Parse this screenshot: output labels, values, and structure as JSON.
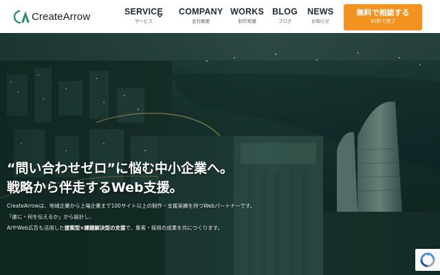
{
  "header": {
    "logo_text": "CreateArrow",
    "nav": [
      {
        "label": "SERVICE",
        "sub": "サービス"
      },
      {
        "label": "COMPANY",
        "sub": "会社概要"
      },
      {
        "label": "WORKS",
        "sub": "制作実績"
      },
      {
        "label": "BLOG",
        "sub": "ブログ"
      },
      {
        "label": "NEWS",
        "sub": "お知らせ"
      }
    ],
    "cta": {
      "label": "無料で相談する",
      "sub": "30秒で完了"
    }
  },
  "hero": {
    "headline_line1": "“問い合わせゼロ”に悩む中小企業へ。",
    "headline_line2": "戦略から伴走するWeb支援。",
    "desc_line1": "CreateArrowは、地域企業から上場企業まで100サイト以上の制作・支援実績を持つWebパートナーです。",
    "desc_line2": "「誰に・何を伝えるか」から設計し、",
    "desc_line3_a": "AIやWeb広告も活用した",
    "desc_line3_b": "提案型×課題解決型の支援",
    "desc_line3_c": "で、集客・採用の成果を共につくります。"
  },
  "colors": {
    "accent": "#f1931e",
    "logo_green": "#2f8f6e",
    "nav_text": "#1e2a35"
  },
  "icons": {
    "logo": "createarrow-logo-icon",
    "service_chevron": "chevron-down-icon",
    "recaptcha": "recaptcha-icon"
  }
}
